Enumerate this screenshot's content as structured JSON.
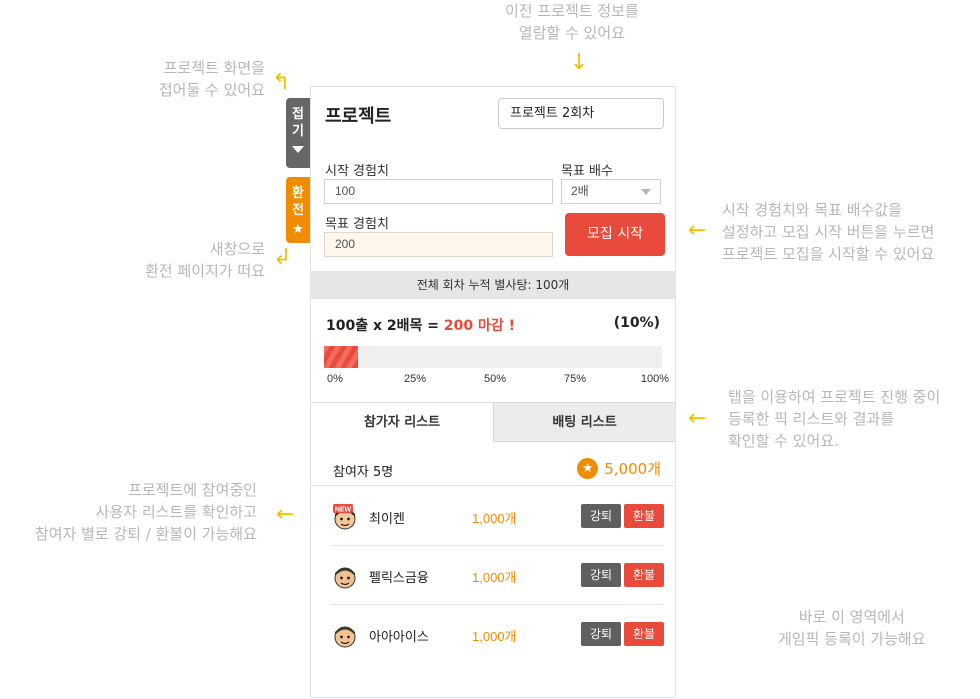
{
  "annotations": {
    "top": "이전 프로젝트 정보를\n열람할 수 있어요",
    "fold": "프로젝트 화면을\n접어둘 수 있어요",
    "swap": "새창으로\n환전 페이지가 떠요",
    "start": "시작 경험치와 목표 배수값을\n설정하고 모집 시작 버튼을 누르면\n프로젝트 모집을 시작할 수 있어요",
    "tabs": "탭을 이용하여 프로젝트 진행 중이\n등록한 픽 리스트와 결과를\n확인할 수 있어요.",
    "participants": "프로젝트에 참여중인\n사용자 리스트를 확인하고\n참여자 별로 강퇴 / 환불이 가능해요",
    "bottom": "바로 이 영역에서\n게임픽 등록이 가능해요"
  },
  "side_tabs": {
    "fold_label": "접기",
    "swap_label": "환전"
  },
  "panel": {
    "title": "프로젝트",
    "round": "프로젝트 2회차",
    "start_exp_label": "시작 경험치",
    "start_exp_value": "100",
    "multiplier_label": "목표 배수",
    "multiplier_value": "2배",
    "target_exp_label": "목표 경험치",
    "target_exp_value": "200",
    "start_button": "모집 시작",
    "summary": "전체 회차 누적 별사탕: 100개",
    "formula_prefix": "100출 x 2배목 = ",
    "formula_highlight": "200 마감 !",
    "percent_label": "(10%)",
    "progress": 0.1,
    "ticks": [
      "0%",
      "25%",
      "50%",
      "75%",
      "100%"
    ],
    "tab_participants": "참가자 리스트",
    "tab_betting": "배팅 리스트",
    "participant_count": "참여자 5명",
    "total_amount": "5,000개",
    "kick_label": "강퇴",
    "refund_label": "환불",
    "participants": [
      {
        "name": "최이켄",
        "amount": "1,000개",
        "avatar_badge": "NEW"
      },
      {
        "name": "펠릭스금융",
        "amount": "1,000개"
      },
      {
        "name": "아아아이스",
        "amount": "1,000개"
      }
    ]
  },
  "colors": {
    "accent_red": "#e84a3b",
    "accent_orange": "#f08c00",
    "annotation_arrow": "#f2c200"
  }
}
